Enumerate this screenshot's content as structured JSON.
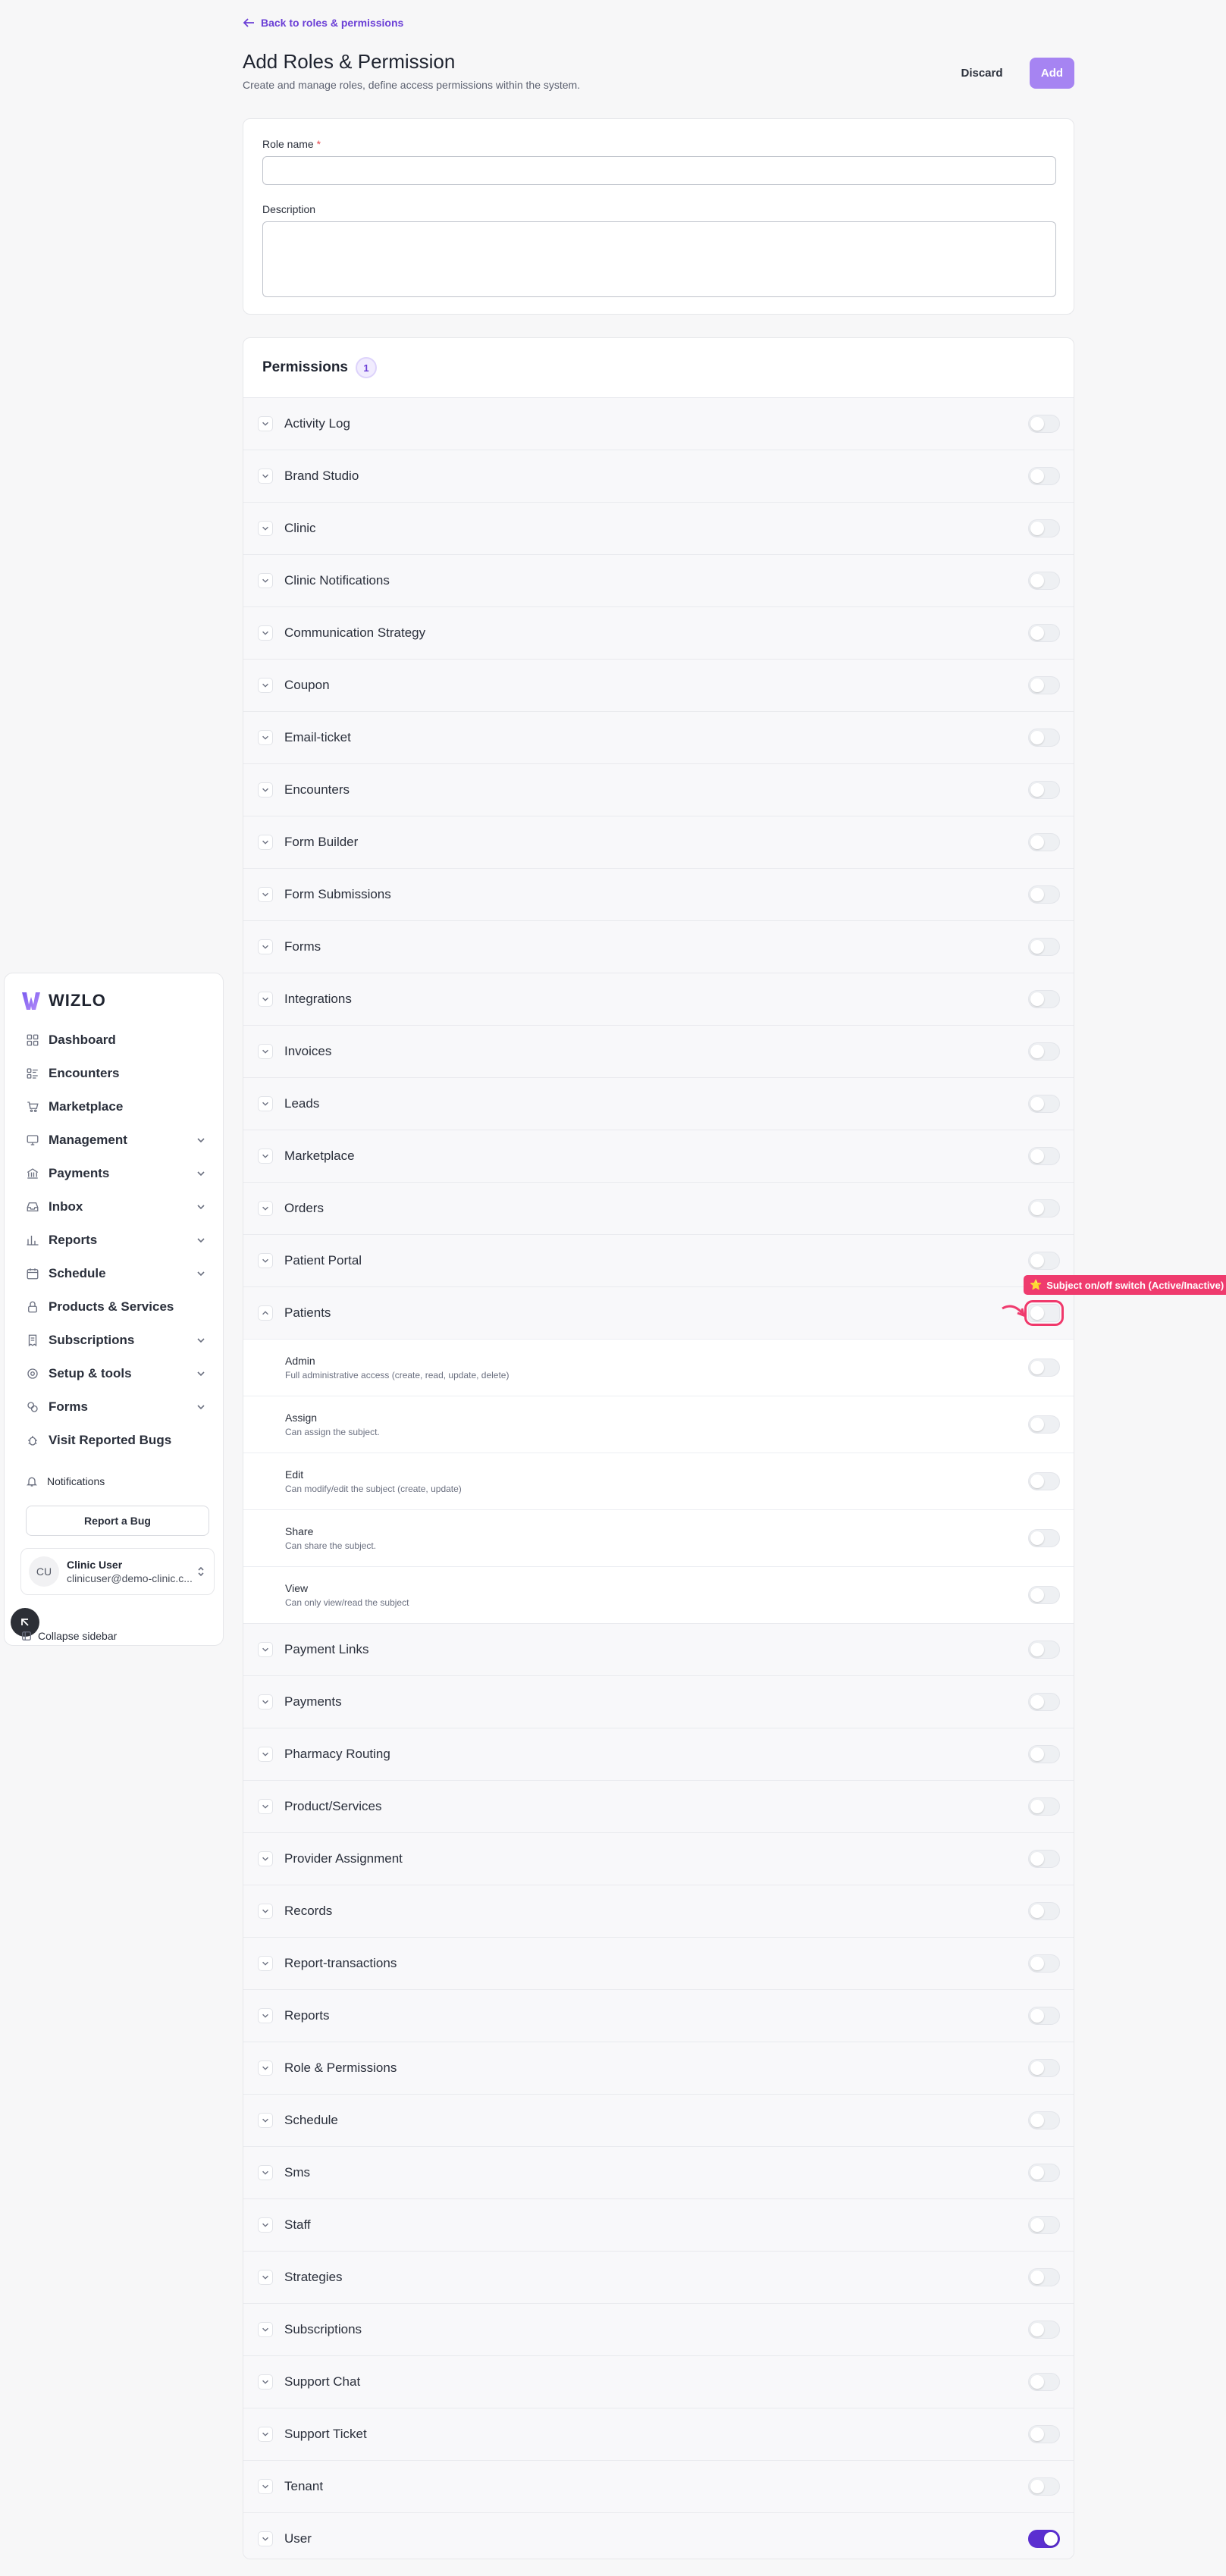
{
  "sidebar": {
    "brand": "WIZLO",
    "items": [
      {
        "label": "Dashboard",
        "icon": "dashboard-icon",
        "chevron": false
      },
      {
        "label": "Encounters",
        "icon": "encounters-icon",
        "chevron": false
      },
      {
        "label": "Marketplace",
        "icon": "cart-icon",
        "chevron": false
      },
      {
        "label": "Management",
        "icon": "monitor-icon",
        "chevron": true
      },
      {
        "label": "Payments",
        "icon": "bank-icon",
        "chevron": true
      },
      {
        "label": "Inbox",
        "icon": "inbox-icon",
        "chevron": true
      },
      {
        "label": "Reports",
        "icon": "chart-icon",
        "chevron": true
      },
      {
        "label": "Schedule",
        "icon": "calendar-icon",
        "chevron": true
      },
      {
        "label": "Products & Services",
        "icon": "lock-icon",
        "chevron": false
      },
      {
        "label": "Subscriptions",
        "icon": "receipt-icon",
        "chevron": true
      },
      {
        "label": "Setup & tools",
        "icon": "gear-icon",
        "chevron": true
      },
      {
        "label": "Forms",
        "icon": "forms-icon",
        "chevron": true
      },
      {
        "label": "Visit Reported Bugs",
        "icon": "bug-icon",
        "chevron": false
      }
    ],
    "notifications_label": "Notifications",
    "report_bug_label": "Report a Bug",
    "user": {
      "initials": "CU",
      "name": "Clinic User",
      "email": "clinicuser@demo-clinic.c..."
    },
    "collapse_label": "Collapse sidebar"
  },
  "header": {
    "back_label": "Back to roles & permissions",
    "title": "Add Roles & Permission",
    "subtitle": "Create and manage roles, define access permissions within the system.",
    "discard_label": "Discard",
    "add_label": "Add"
  },
  "form": {
    "role_name_label": "Role name",
    "required_mark": "*",
    "role_name_value": "",
    "description_label": "Description",
    "description_value": ""
  },
  "permissions": {
    "title": "Permissions",
    "count": "1",
    "rows": [
      {
        "label": "Activity Log",
        "on": false
      },
      {
        "label": "Brand Studio",
        "on": false
      },
      {
        "label": "Clinic",
        "on": false
      },
      {
        "label": "Clinic Notifications",
        "on": false
      },
      {
        "label": "Communication Strategy",
        "on": false
      },
      {
        "label": "Coupon",
        "on": false
      },
      {
        "label": "Email-ticket",
        "on": false
      },
      {
        "label": "Encounters",
        "on": false
      },
      {
        "label": "Form Builder",
        "on": false
      },
      {
        "label": "Form Submissions",
        "on": false
      },
      {
        "label": "Forms",
        "on": false
      },
      {
        "label": "Integrations",
        "on": false
      },
      {
        "label": "Invoices",
        "on": false
      },
      {
        "label": "Leads",
        "on": false
      },
      {
        "label": "Marketplace",
        "on": false
      },
      {
        "label": "Orders",
        "on": false
      },
      {
        "label": "Patient Portal",
        "on": false
      },
      {
        "label": "Patients",
        "on": false,
        "expanded": true,
        "highlight": true,
        "subs": [
          {
            "title": "Admin",
            "desc": "Full administrative access (create, read, update, delete)",
            "on": false
          },
          {
            "title": "Assign",
            "desc": "Can assign the subject.",
            "on": false
          },
          {
            "title": "Edit",
            "desc": "Can modify/edit the subject (create, update)",
            "on": false
          },
          {
            "title": "Share",
            "desc": "Can share the subject.",
            "on": false
          },
          {
            "title": "View",
            "desc": "Can only view/read the subject",
            "on": false
          }
        ]
      },
      {
        "label": "Payment Links",
        "on": false
      },
      {
        "label": "Payments",
        "on": false
      },
      {
        "label": "Pharmacy Routing",
        "on": false
      },
      {
        "label": "Product/Services",
        "on": false
      },
      {
        "label": "Provider Assignment",
        "on": false
      },
      {
        "label": "Records",
        "on": false
      },
      {
        "label": "Report-transactions",
        "on": false
      },
      {
        "label": "Reports",
        "on": false
      },
      {
        "label": "Role & Permissions",
        "on": false
      },
      {
        "label": "Schedule",
        "on": false
      },
      {
        "label": "Sms",
        "on": false
      },
      {
        "label": "Staff",
        "on": false
      },
      {
        "label": "Strategies",
        "on": false
      },
      {
        "label": "Subscriptions",
        "on": false
      },
      {
        "label": "Support Chat",
        "on": false
      },
      {
        "label": "Support Ticket",
        "on": false
      },
      {
        "label": "Tenant",
        "on": false
      },
      {
        "label": "User",
        "on": true
      }
    ]
  },
  "callout": {
    "star": "⭐",
    "text": "Subject on/off switch (Active/Inactive)"
  },
  "colors": {
    "accent": "#5b2fd0",
    "add_button": "#a684f2",
    "callout": "#ef3b6e"
  }
}
